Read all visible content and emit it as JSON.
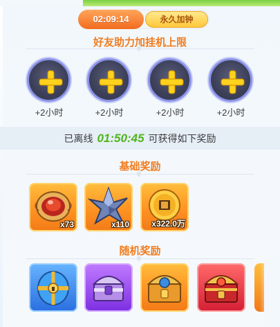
{
  "timer": {
    "time": "02:09:14",
    "button_label": "永久加钟"
  },
  "helpers": {
    "title": "好友助力加挂机上限",
    "slots": [
      {
        "label": "+2小时"
      },
      {
        "label": "+2小时"
      },
      {
        "label": "+2小时"
      },
      {
        "label": "+2小时"
      }
    ]
  },
  "offline": {
    "prefix": "已离线",
    "time": "01:50:45",
    "suffix": "可获得如下奖励"
  },
  "base_rewards": {
    "title": "基础奖励",
    "items": [
      {
        "icon": "red-gem-orb-icon",
        "qty": "x73"
      },
      {
        "icon": "blue-crystal-icon",
        "qty": "x110"
      },
      {
        "icon": "gold-coin-icon",
        "qty": "x322.0万"
      }
    ]
  },
  "random_rewards": {
    "title": "随机奖励",
    "items": [
      {
        "icon": "blue-gold-chest-icon",
        "color": "#2a6fe0"
      },
      {
        "icon": "purple-chest-icon",
        "color": "#7c2ee0"
      },
      {
        "icon": "orange-chest-icon",
        "color": "#f27a17"
      },
      {
        "icon": "red-chest-icon",
        "color": "#d41e35"
      }
    ]
  }
}
